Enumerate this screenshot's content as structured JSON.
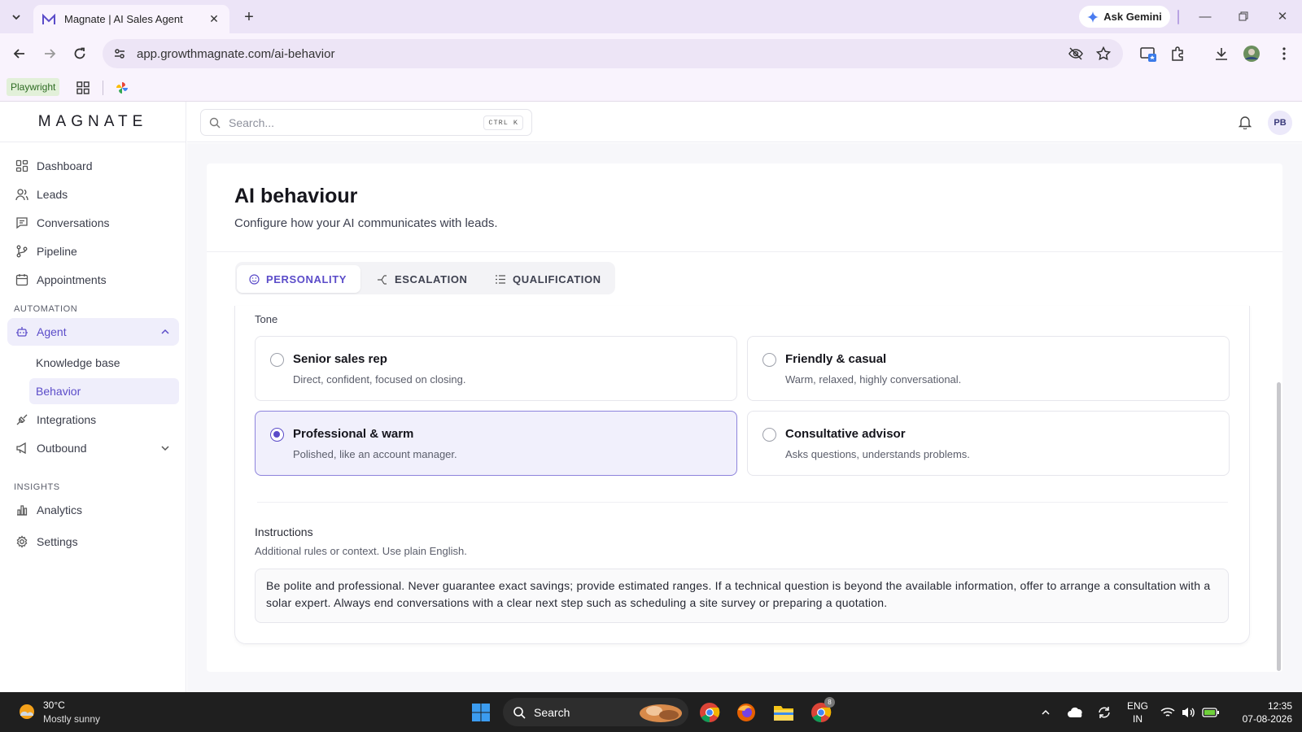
{
  "browser": {
    "tab_title": "Magnate | AI Sales Agent",
    "url": "app.growthmagnate.com/ai-behavior",
    "gemini_label": "Ask Gemini",
    "bookmark_playwright": "Playwright"
  },
  "app": {
    "logo": "MAGNATE",
    "search_placeholder": "Search...",
    "search_shortcut": "CTRL K",
    "avatar_initials": "PB",
    "accent_color": "#5b4cc9"
  },
  "sidebar": {
    "items": [
      {
        "label": "Dashboard",
        "icon": "dashboard-icon"
      },
      {
        "label": "Leads",
        "icon": "users-icon"
      },
      {
        "label": "Conversations",
        "icon": "chat-icon"
      },
      {
        "label": "Pipeline",
        "icon": "git-branch-icon"
      },
      {
        "label": "Appointments",
        "icon": "calendar-icon"
      }
    ],
    "automation_label": "AUTOMATION",
    "agent": {
      "label": "Agent",
      "icon": "bot-icon"
    },
    "agent_sub": [
      "Knowledge base",
      "Behavior"
    ],
    "integrations": "Integrations",
    "outbound": "Outbound",
    "insights_label": "INSIGHTS",
    "analytics": "Analytics",
    "settings": "Settings"
  },
  "page": {
    "title": "AI behaviour",
    "subtitle": "Configure how your AI communicates with leads.",
    "tabs": [
      "PERSONALITY",
      "ESCALATION",
      "QUALIFICATION"
    ],
    "active_tab": "PERSONALITY"
  },
  "tone": {
    "label": "Tone",
    "options": [
      {
        "title": "Senior sales rep",
        "desc": "Direct, confident, focused on closing.",
        "selected": false
      },
      {
        "title": "Friendly & casual",
        "desc": "Warm, relaxed, highly conversational.",
        "selected": false
      },
      {
        "title": "Professional & warm",
        "desc": "Polished, like an account manager.",
        "selected": true
      },
      {
        "title": "Consultative advisor",
        "desc": "Asks questions, understands problems.",
        "selected": false
      }
    ]
  },
  "instructions": {
    "label": "Instructions",
    "sub": "Additional rules or context. Use plain English.",
    "value": "Be polite and professional. Never guarantee exact savings; provide estimated ranges. If a technical question is beyond the available information, offer to arrange a consultation with a solar expert. Always end conversations with a clear next step such as scheduling a site survey or preparing a quotation."
  },
  "taskbar": {
    "temp": "30°C",
    "weather": "Mostly sunny",
    "search_label": "Search",
    "lang_top": "ENG",
    "lang_bottom": "IN",
    "time": "12:35",
    "date": "07-08-2026",
    "chrome_badge": "8"
  }
}
